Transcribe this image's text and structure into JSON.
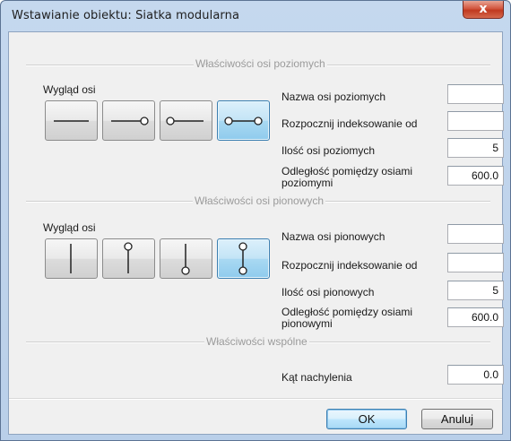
{
  "window": {
    "title": "Wstawianie obiektu: Siatka modularna",
    "close_glyph": "x"
  },
  "horizontal": {
    "section_title": "Właściwości osi poziomych",
    "appearance_label": "Wygląd osi",
    "styles": [
      "axis-line",
      "axis-line-end-circle",
      "axis-line-start-circle",
      "axis-line-both-circles"
    ],
    "selected_style": 3,
    "name_label": "Nazwa osi poziomych",
    "name_value": "",
    "start_index_label": "Rozpocznij indeksowanie od",
    "start_index_value": "",
    "count_label": "Ilość osi poziomych",
    "count_value": "5",
    "spacing_label_1": "Odległość pomiędzy osiami",
    "spacing_label_2": "poziomymi",
    "spacing_value": "600.0"
  },
  "vertical": {
    "section_title": "Właściwości osi pionowych",
    "appearance_label": "Wygląd osi",
    "styles": [
      "axis-line",
      "axis-line-top-circle",
      "axis-line-bottom-circle",
      "axis-line-both-circles"
    ],
    "selected_style": 3,
    "name_label": "Nazwa osi pionowych",
    "name_value": "",
    "start_index_label": "Rozpocznij indeksowanie od",
    "start_index_value": "",
    "count_label": "Ilość osi pionowych",
    "count_value": "5",
    "spacing_label_1": "Odległość pomiędzy osiami",
    "spacing_label_2": "pionowymi",
    "spacing_value": "600.0"
  },
  "common": {
    "section_title": "Właściwości wspólne",
    "angle_label": "Kąt nachylenia",
    "angle_value": "0.0"
  },
  "buttons": {
    "ok": "OK",
    "cancel": "Anuluj"
  },
  "colors": {
    "selected_button": "#a9d9f2",
    "close_button": "#c0391f",
    "section_text": "#9b9b9b"
  }
}
